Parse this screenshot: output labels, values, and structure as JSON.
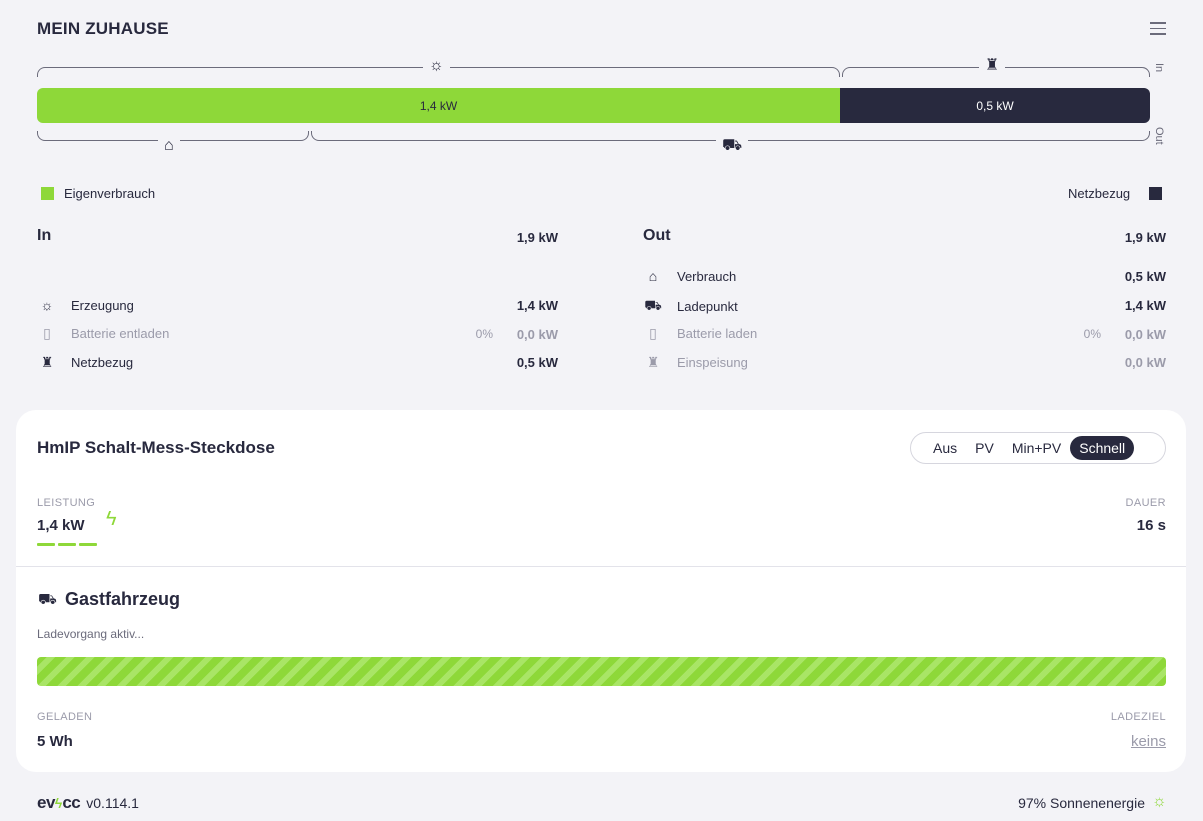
{
  "header": {
    "title": "MEIN ZUHAUSE"
  },
  "energyflow": {
    "bar_left_value": "1,4 kW",
    "bar_right_value": "0,5 kW",
    "in_side_label": "In",
    "out_side_label": "Out",
    "legend_left": "Eigenverbrauch",
    "legend_right": "Netzbezug",
    "legend_left_color": "#8ed839",
    "legend_right_color": "#28293e"
  },
  "in": {
    "title": "In",
    "total": "1,9 kW",
    "rows": [
      {
        "icon": "sun-icon",
        "label": "Erzeugung",
        "pct": "",
        "value": "1,4 kW",
        "muted": false
      },
      {
        "icon": "battery-icon",
        "label": "Batterie entladen",
        "pct": "0%",
        "value": "0,0 kW",
        "muted": true
      },
      {
        "icon": "grid-tower-icon",
        "label": "Netzbezug",
        "pct": "",
        "value": "0,5 kW",
        "muted": false
      }
    ]
  },
  "out": {
    "title": "Out",
    "total": "1,9 kW",
    "rows": [
      {
        "icon": "house-icon",
        "label": "Verbrauch",
        "pct": "",
        "value": "0,5 kW",
        "muted": false
      },
      {
        "icon": "car-icon",
        "label": "Ladepunkt",
        "pct": "",
        "value": "1,4 kW",
        "muted": false
      },
      {
        "icon": "battery-icon",
        "label": "Batterie laden",
        "pct": "0%",
        "value": "0,0 kW",
        "muted": true
      },
      {
        "icon": "grid-tower-icon",
        "label": "Einspeisung",
        "pct": "",
        "value": "0,0 kW",
        "muted": true
      }
    ]
  },
  "loadpoint": {
    "title": "HmIP Schalt-Mess-Steckdose",
    "modes": [
      "Aus",
      "PV",
      "Min+PV",
      "Schnell"
    ],
    "active_mode": "Schnell",
    "power_label": "LEISTUNG",
    "power_value": "1,4 kW",
    "duration_label": "DAUER",
    "duration_value": "16 s",
    "vehicle_name": "Gastfahrzeug",
    "status": "Ladevorgang aktiv...",
    "charged_label": "GELADEN",
    "charged_value": "5 Wh",
    "target_label": "LADEZIEL",
    "target_value": "keins"
  },
  "footer": {
    "logo_ev": "ev",
    "logo_cc": "cc",
    "version": "v0.114.1",
    "solar_share": "97% Sonnenenergie"
  }
}
